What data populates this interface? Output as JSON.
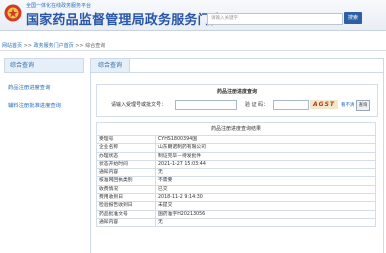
{
  "header": {
    "pretitle": "全国一体化在线政务服务平台",
    "title": "国家药品监督管理局政务服务门户",
    "search_placeholder": "请输入关键字",
    "search_button": "搜索"
  },
  "breadcrumb": {
    "home": "网站首页",
    "sep": ">>",
    "level1": "政务服务门户首页",
    "level2": "综合查询"
  },
  "sidebar": {
    "head": "综合查询",
    "items": [
      {
        "label": "药品注册进度查询"
      },
      {
        "label": "辅料注册批准进度查询"
      }
    ]
  },
  "main": {
    "tab": "综合查询",
    "query": {
      "title": "药品注册进度查询",
      "code_label": "请输入受理号或批文号：",
      "captcha_label": "验 证 码：",
      "captcha_text": "AGST",
      "refresh_link": "看不清",
      "query_button": "查询"
    },
    "result": {
      "title": "药品注册进度查询结果",
      "rows": [
        {
          "k": "受理号",
          "v": "CYHS1800394国"
        },
        {
          "k": "企业名称",
          "v": "山东朗诺制药有限公司"
        },
        {
          "k": "办理状态",
          "v": "制证完毕－待发批件"
        },
        {
          "k": "状态开始时间",
          "v": "2021-1-27 15:03:44"
        },
        {
          "k": "通知内容",
          "v": "无"
        },
        {
          "k": "核准网回执类别",
          "v": "不需要"
        },
        {
          "k": "收费情况",
          "v": "已交"
        },
        {
          "k": "费用收到日",
          "v": "2018-11-2 9:14:30"
        },
        {
          "k": "检验报告收到日",
          "v": "未提交"
        },
        {
          "k": "药品批准文号",
          "v": "国药准字H20213056"
        },
        {
          "k": "通知内容",
          "v": "无"
        }
      ]
    }
  },
  "colors": {
    "brand_blue": "#2a56a8",
    "link_blue": "#2a6fb3",
    "logo_red": "#d23a2a"
  }
}
